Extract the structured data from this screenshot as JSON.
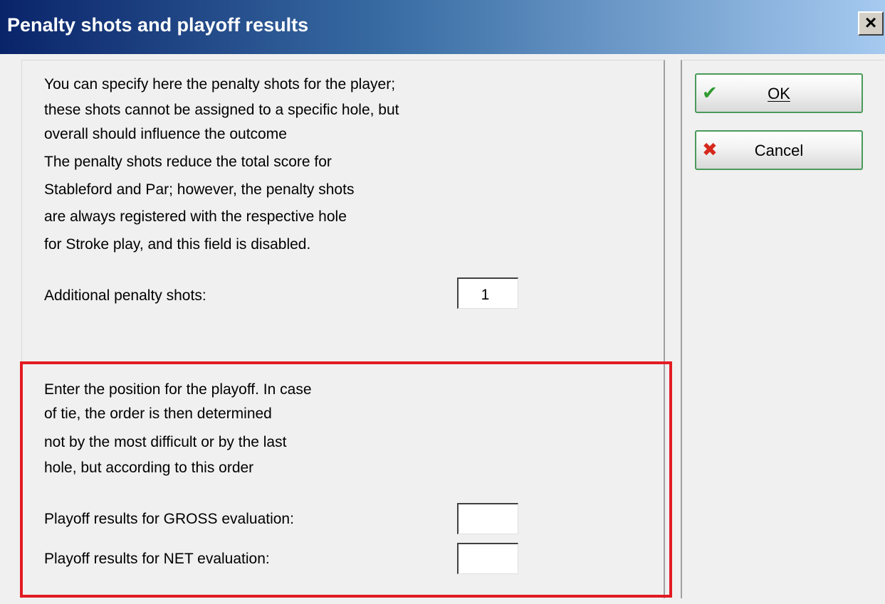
{
  "window": {
    "title": "Penalty shots and playoff results",
    "close_glyph": "×"
  },
  "penalty": {
    "lines": [
      "You can specify here the penalty shots for the player;",
      "these shots cannot be assigned to a specific hole, but",
      "overall should influence the outcome",
      "The penalty shots reduce the total score for",
      "Stableford and Par; however, the penalty shots",
      "are always registered with the respective hole",
      "for Stroke play, and this field is disabled."
    ],
    "field_label": "Additional penalty shots:",
    "field_value": "1"
  },
  "playoff": {
    "lines": [
      "Enter the position for the playoff. In case",
      "of tie, the order is then determined",
      "not by the most difficult or by the last",
      "hole, but according to this order"
    ],
    "gross_label": "Playoff results for GROSS evaluation:",
    "gross_value": "",
    "net_label": "Playoff results for NET evaluation:",
    "net_value": ""
  },
  "buttons": {
    "ok": {
      "label": "OK",
      "icon": "checkmark-icon",
      "glyph": "✔"
    },
    "cancel": {
      "label": "Cancel",
      "icon": "x-icon",
      "glyph": "✖"
    }
  },
  "colors": {
    "highlight": "#e31b23",
    "title_gradient_start": "#0a246a",
    "title_gradient_end": "#a6caf0"
  }
}
